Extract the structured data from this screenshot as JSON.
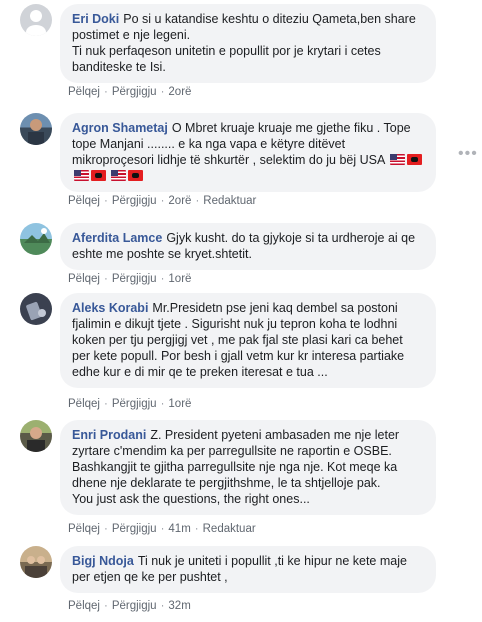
{
  "comments": [
    {
      "author": "Eri Doki",
      "text": "Po si u katandise keshtu o diteziu Qameta,ben share postimet e nje legeni.",
      "text2": "Ti nuk perfaqeson unitetin e popullit por je krytari i cetes banditeske te Isi.",
      "like": "Pëlqej",
      "reply": "Përgjigju",
      "time": "2orë"
    },
    {
      "author": "Agron Shametaj",
      "text": "O Mbret kruaje kruaje me gjethe fiku . Tope tope Manjani ........ e ka nga vapa e këtyre ditëvet mikroproçesori lidhje të shkurtër , selektim do ju bëj USA",
      "like": "Pëlqej",
      "reply": "Përgjigju",
      "time": "2orë",
      "edited": "Redaktuar"
    },
    {
      "author": "Aferdita Lamce",
      "text": "Gjyk kusht. do ta gjykoje si ta urdheroje ai qe eshte me poshte se kryet.shtetit.",
      "like": "Pëlqej",
      "reply": "Përgjigju",
      "time": "1orë"
    },
    {
      "author": "Aleks Korabi",
      "text": "Mr.Presidetn pse jeni kaq dembel sa postoni fjalimin e dikujt tjete . Sigurisht nuk ju tepron koha te lodhni koken per tju pergjigj vet , me pak fjal ste plasi kari ca behet per kete popull. Por besh i gjall vetm kur kr interesa partiake edhe kur e di mir qe te preken iteresat e tua ...",
      "like": "Pëlqej",
      "reply": "Përgjigju",
      "time": "1orë"
    },
    {
      "author": "Enri Prodani",
      "text": "Z. President pyeteni ambasaden me nje leter zyrtare c'mendim ka per parregullsite ne raportin e OSBE. Bashkangjit te gjitha parregullsite nje nga nje. Kot meqe ka dhene nje deklarate te pergjithshme, le ta shtjelloje pak.",
      "text2": "You just ask the questions, the right ones...",
      "like": "Pëlqej",
      "reply": "Përgjigju",
      "time": "41m",
      "edited": "Redaktuar"
    },
    {
      "author": "Bigj Ndoja",
      "text": "Ti nuk je uniteti i popullit ,ti ke hipur ne kete maje per etjen qe ke per pushtet ,",
      "like": "Pëlqej",
      "reply": "Përgjigju",
      "time": "32m"
    }
  ],
  "icons": {
    "more": "more-options-icon",
    "flag_al": "albania-flag-icon",
    "flag_us": "usa-flag-icon"
  },
  "colors": {
    "author": "#385898",
    "bubble": "#f2f3f5",
    "meta": "#606770",
    "text": "#1c1e21"
  }
}
